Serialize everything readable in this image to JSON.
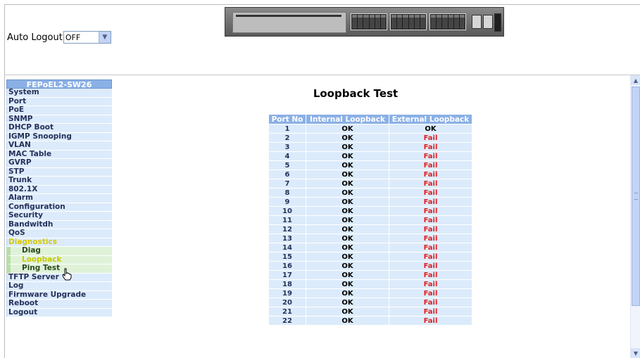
{
  "header": {
    "auto_logout_label": "Auto Logout",
    "auto_logout_value": "OFF"
  },
  "sidebar": {
    "title": "FEPoEL2-SW26",
    "items": [
      {
        "label": "System"
      },
      {
        "label": "Port"
      },
      {
        "label": "PoE"
      },
      {
        "label": "SNMP"
      },
      {
        "label": "DHCP Boot"
      },
      {
        "label": "IGMP Snooping"
      },
      {
        "label": "VLAN"
      },
      {
        "label": "MAC Table"
      },
      {
        "label": "GVRP"
      },
      {
        "label": "STP"
      },
      {
        "label": "Trunk"
      },
      {
        "label": "802.1X"
      },
      {
        "label": "Alarm"
      },
      {
        "label": "Configuration"
      },
      {
        "label": "Security"
      },
      {
        "label": "Bandwitdh"
      },
      {
        "label": "QoS"
      },
      {
        "label": "Diagnostics",
        "active": true
      },
      {
        "label": "Diag",
        "sub": true
      },
      {
        "label": "Loopback",
        "sub": true,
        "active": true
      },
      {
        "label": "Ping Test",
        "sub": true
      },
      {
        "label": "TFTP Server"
      },
      {
        "label": "Log"
      },
      {
        "label": "Firmware Upgrade"
      },
      {
        "label": "Reboot"
      },
      {
        "label": "Logout"
      }
    ]
  },
  "main": {
    "title": "Loopback Test",
    "columns": [
      "Port No",
      "Internal Loopback",
      "External Loopback"
    ],
    "rows": [
      {
        "port": "1",
        "internal": "OK",
        "external": "OK"
      },
      {
        "port": "2",
        "internal": "OK",
        "external": "Fail"
      },
      {
        "port": "3",
        "internal": "OK",
        "external": "Fail"
      },
      {
        "port": "4",
        "internal": "OK",
        "external": "Fail"
      },
      {
        "port": "5",
        "internal": "OK",
        "external": "Fail"
      },
      {
        "port": "6",
        "internal": "OK",
        "external": "Fail"
      },
      {
        "port": "7",
        "internal": "OK",
        "external": "Fail"
      },
      {
        "port": "8",
        "internal": "OK",
        "external": "Fail"
      },
      {
        "port": "9",
        "internal": "OK",
        "external": "Fail"
      },
      {
        "port": "10",
        "internal": "OK",
        "external": "Fail"
      },
      {
        "port": "11",
        "internal": "OK",
        "external": "Fail"
      },
      {
        "port": "12",
        "internal": "OK",
        "external": "Fail"
      },
      {
        "port": "13",
        "internal": "OK",
        "external": "Fail"
      },
      {
        "port": "14",
        "internal": "OK",
        "external": "Fail"
      },
      {
        "port": "15",
        "internal": "OK",
        "external": "Fail"
      },
      {
        "port": "16",
        "internal": "OK",
        "external": "Fail"
      },
      {
        "port": "17",
        "internal": "OK",
        "external": "Fail"
      },
      {
        "port": "18",
        "internal": "OK",
        "external": "Fail"
      },
      {
        "port": "19",
        "internal": "OK",
        "external": "Fail"
      },
      {
        "port": "20",
        "internal": "OK",
        "external": "Fail"
      },
      {
        "port": "21",
        "internal": "OK",
        "external": "Fail"
      },
      {
        "port": "22",
        "internal": "OK",
        "external": "Fail"
      }
    ]
  },
  "colors": {
    "header_blue": "#8ab0e6",
    "cell_blue": "#dcebfb",
    "fail_red": "#e02020",
    "active_yellow": "#d4c800",
    "submenu_green": "#dff2d8"
  },
  "icons": {
    "dropdown": "chevron-down-icon",
    "cursor": "hand-pointer-icon",
    "device": "switch-device-icon"
  }
}
